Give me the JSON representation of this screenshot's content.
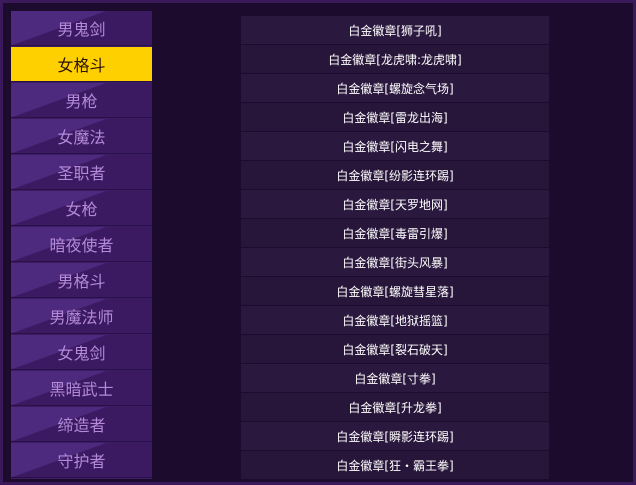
{
  "sidebar": {
    "active_index": 1,
    "items": [
      {
        "label": "男鬼剑"
      },
      {
        "label": "女格斗"
      },
      {
        "label": "男枪"
      },
      {
        "label": "女魔法"
      },
      {
        "label": "圣职者"
      },
      {
        "label": "女枪"
      },
      {
        "label": "暗夜使者"
      },
      {
        "label": "男格斗"
      },
      {
        "label": "男魔法师"
      },
      {
        "label": "女鬼剑"
      },
      {
        "label": "黑暗武士"
      },
      {
        "label": "缔造者"
      },
      {
        "label": "守护者"
      }
    ]
  },
  "badges": {
    "items": [
      {
        "label": "白金徽章[狮子吼]"
      },
      {
        "label": "白金徽章[龙虎啸:龙虎啸]"
      },
      {
        "label": "白金徽章[螺旋念气场]"
      },
      {
        "label": "白金徽章[雷龙出海]"
      },
      {
        "label": "白金徽章[闪电之舞]"
      },
      {
        "label": "白金徽章[纷影连环踢]"
      },
      {
        "label": "白金徽章[天罗地网]"
      },
      {
        "label": "白金徽章[毒雷引爆]"
      },
      {
        "label": "白金徽章[街头风暴]"
      },
      {
        "label": "白金徽章[螺旋彗星落]"
      },
      {
        "label": "白金徽章[地狱摇篮]"
      },
      {
        "label": "白金徽章[裂石破天]"
      },
      {
        "label": "白金徽章[寸拳]"
      },
      {
        "label": "白金徽章[升龙拳]"
      },
      {
        "label": "白金徽章[瞬影连环踢]"
      },
      {
        "label": "白金徽章[狂・霸王拳]"
      }
    ]
  },
  "colors": {
    "background": "#1c0b2c",
    "sidebar_item": "#3b1a62",
    "sidebar_text": "#b48ad8",
    "active_item": "#ffd000",
    "row_bg": "#27163a",
    "row_text": "#ffffff"
  }
}
